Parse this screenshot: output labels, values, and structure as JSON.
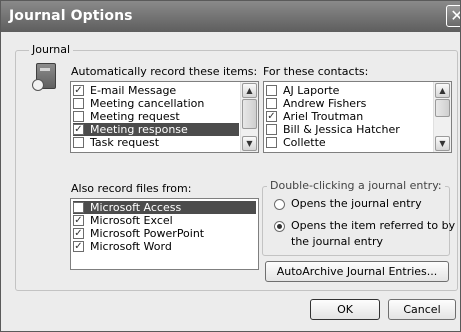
{
  "window": {
    "title": "Journal Options"
  },
  "journal_group": {
    "label": "Journal"
  },
  "auto_record": {
    "label": "Automatically record these items:",
    "items": [
      {
        "label": "E-mail Message",
        "checked": true,
        "selected": false
      },
      {
        "label": "Meeting cancellation",
        "checked": false,
        "selected": false
      },
      {
        "label": "Meeting request",
        "checked": false,
        "selected": false
      },
      {
        "label": "Meeting response",
        "checked": true,
        "selected": true
      },
      {
        "label": "Task request",
        "checked": false,
        "selected": false
      }
    ]
  },
  "contacts": {
    "label": "For these contacts:",
    "items": [
      {
        "label": "AJ Laporte",
        "checked": false
      },
      {
        "label": "Andrew Fishers",
        "checked": false
      },
      {
        "label": "Ariel Troutman",
        "checked": true
      },
      {
        "label": "Bill & Jessica Hatcher",
        "checked": false
      },
      {
        "label": "Collette",
        "checked": false
      }
    ]
  },
  "record_files": {
    "label": "Also record files from:",
    "items": [
      {
        "label": "Microsoft Access",
        "checked": false,
        "selected": true
      },
      {
        "label": "Microsoft Excel",
        "checked": true,
        "selected": false
      },
      {
        "label": "Microsoft PowerPoint",
        "checked": true,
        "selected": false
      },
      {
        "label": "Microsoft Word",
        "checked": true,
        "selected": false
      }
    ]
  },
  "double_click": {
    "label": "Double-clicking a journal entry:",
    "options": [
      {
        "label_line1": "Opens the journal entry",
        "label_line2": "",
        "selected": false
      },
      {
        "label_line1": "Opens the item referred to by",
        "label_line2": "the journal entry",
        "selected": true
      }
    ]
  },
  "buttons": {
    "autoarchive": "AutoArchive Journal Entries...",
    "ok": "OK",
    "cancel": "Cancel",
    "close_glyph": "✕"
  },
  "scroll_glyphs": {
    "up": "▲",
    "down": "▼"
  },
  "colors": {
    "selection": "#4c4c4c",
    "titlebar": "#6e6e6e",
    "dialog_bg": "#ececec"
  }
}
